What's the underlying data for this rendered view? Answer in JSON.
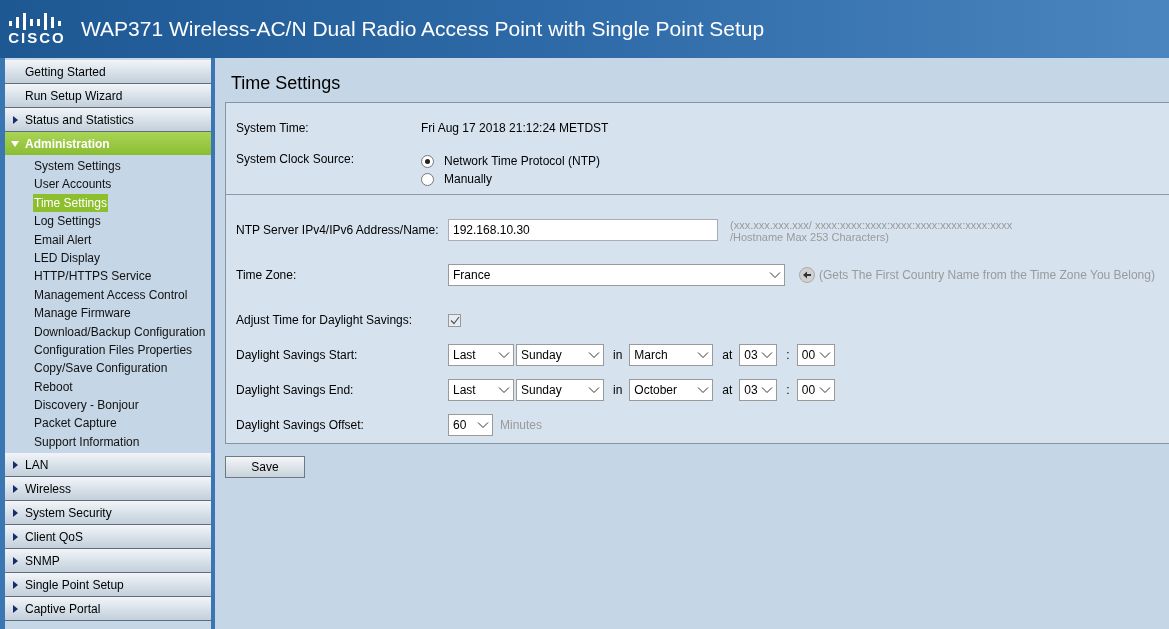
{
  "header": {
    "logo_text": "CISCO",
    "title": "WAP371 Wireless-AC/N Dual Radio Access Point with Single Point Setup"
  },
  "sidebar": {
    "items": [
      {
        "label": "Getting Started",
        "kind": "link",
        "expanded": false
      },
      {
        "label": "Run Setup Wizard",
        "kind": "link",
        "expanded": false
      },
      {
        "label": "Status and Statistics",
        "kind": "group",
        "expanded": false
      },
      {
        "label": "Administration",
        "kind": "group",
        "expanded": true,
        "children": [
          {
            "label": "System Settings",
            "selected": false
          },
          {
            "label": "User Accounts",
            "selected": false
          },
          {
            "label": "Time Settings",
            "selected": true
          },
          {
            "label": "Log Settings",
            "selected": false
          },
          {
            "label": "Email Alert",
            "selected": false
          },
          {
            "label": "LED Display",
            "selected": false
          },
          {
            "label": "HTTP/HTTPS Service",
            "selected": false
          },
          {
            "label": "Management Access Control",
            "selected": false
          },
          {
            "label": "Manage Firmware",
            "selected": false
          },
          {
            "label": "Download/Backup Configuration",
            "selected": false
          },
          {
            "label": "Configuration Files Properties",
            "selected": false
          },
          {
            "label": "Copy/Save Configuration",
            "selected": false
          },
          {
            "label": "Reboot",
            "selected": false
          },
          {
            "label": "Discovery - Bonjour",
            "selected": false
          },
          {
            "label": "Packet Capture",
            "selected": false
          },
          {
            "label": "Support Information",
            "selected": false
          }
        ]
      },
      {
        "label": "LAN",
        "kind": "group",
        "expanded": false
      },
      {
        "label": "Wireless",
        "kind": "group",
        "expanded": false
      },
      {
        "label": "System Security",
        "kind": "group",
        "expanded": false
      },
      {
        "label": "Client QoS",
        "kind": "group",
        "expanded": false
      },
      {
        "label": "SNMP",
        "kind": "group",
        "expanded": false
      },
      {
        "label": "Single Point Setup",
        "kind": "group",
        "expanded": false
      },
      {
        "label": "Captive Portal",
        "kind": "group",
        "expanded": false
      }
    ]
  },
  "page": {
    "title": "Time Settings",
    "system_time": {
      "label": "System Time:",
      "value": "Fri Aug 17 2018 21:12:24 METDST"
    },
    "clock_source": {
      "label": "System Clock Source:",
      "options": [
        {
          "label": "Network Time Protocol (NTP)",
          "selected": true
        },
        {
          "label": "Manually",
          "selected": false
        }
      ]
    },
    "ntp_server": {
      "label": "NTP Server IPv4/IPv6 Address/Name:",
      "value": "192.168.10.30",
      "hint": [
        "(xxx.xxx.xxx.xxx/ xxxx:xxxx:xxxx:xxxx:xxxx:xxxx:xxxx:xxxx",
        "/Hostname Max 253 Characters)"
      ]
    },
    "time_zone": {
      "label": "Time Zone:",
      "value": "France",
      "hint": "(Gets The First Country Name from the Time Zone You Belong)"
    },
    "daylight_savings": {
      "label": "Adjust Time for Daylight Savings:",
      "checked": true
    },
    "dst_start": {
      "label": "Daylight Savings Start:",
      "parts": [
        {
          "kind": "select",
          "value": "Last"
        },
        {
          "kind": "select",
          "value": "Sunday"
        },
        {
          "kind": "text",
          "text": "in"
        },
        {
          "kind": "select",
          "value": "March"
        },
        {
          "kind": "text",
          "text": "at"
        },
        {
          "kind": "select",
          "value": "03"
        },
        {
          "kind": "text",
          "text": ":"
        },
        {
          "kind": "select",
          "value": "00"
        }
      ]
    },
    "dst_end": {
      "label": "Daylight Savings End:",
      "parts": [
        {
          "kind": "select",
          "value": "Last"
        },
        {
          "kind": "select",
          "value": "Sunday"
        },
        {
          "kind": "text",
          "text": "in"
        },
        {
          "kind": "select",
          "value": "October"
        },
        {
          "kind": "text",
          "text": "at"
        },
        {
          "kind": "select",
          "value": "03"
        },
        {
          "kind": "text",
          "text": ":"
        },
        {
          "kind": "select",
          "value": "00"
        }
      ]
    },
    "dst_offset": {
      "label": "Daylight Savings Offset:",
      "value": "60",
      "unit": "Minutes"
    },
    "save_button": "Save"
  }
}
